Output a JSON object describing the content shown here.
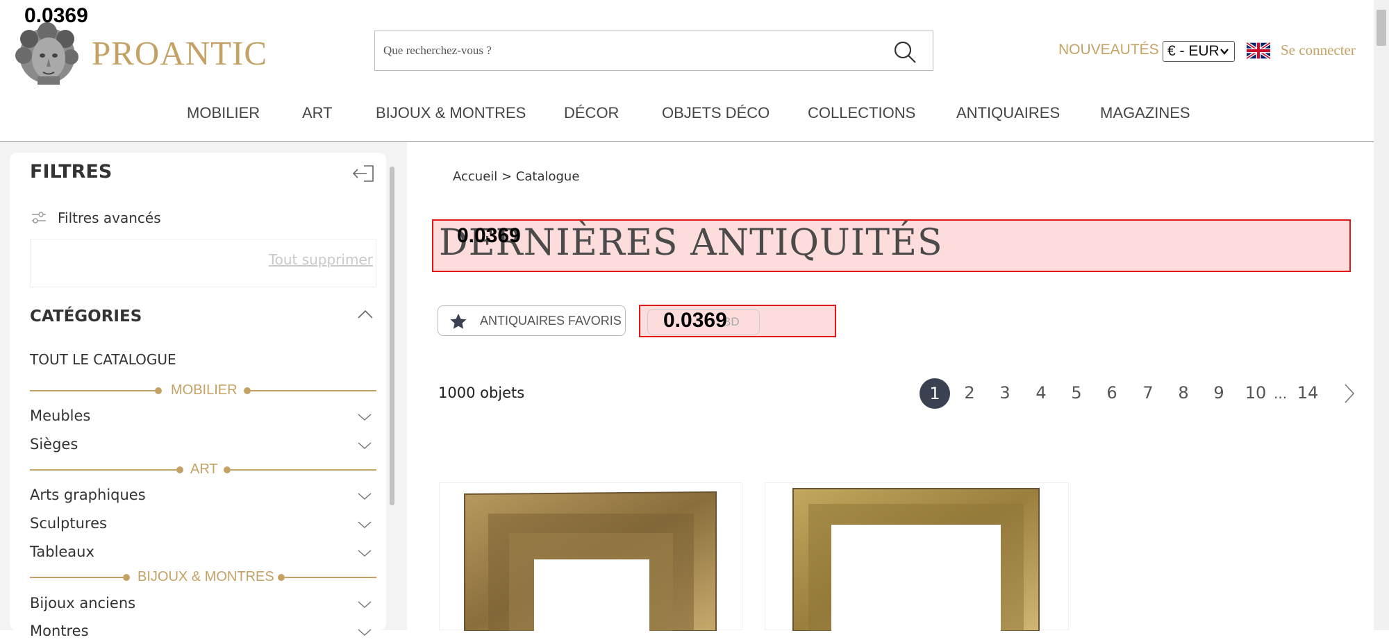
{
  "overlay_value": "0.0369",
  "brand": {
    "name": "PROANTIC"
  },
  "search": {
    "placeholder": "Que recherchez-vous ?"
  },
  "header": {
    "nouveautes": "NOUVEAUTÉS",
    "currency": "€ - EUR",
    "login": "Se connecter"
  },
  "nav": {
    "items": [
      "MOBILIER",
      "ART",
      "BIJOUX & MONTRES",
      "DÉCOR",
      "OBJETS DÉCO",
      "COLLECTIONS",
      "ANTIQUAIRES",
      "MAGAZINES"
    ]
  },
  "sidebar": {
    "title": "FILTRES",
    "advanced": "Filtres avancés",
    "clear_all": "Tout supprimer",
    "categories_title": "CATÉGORIES",
    "all_catalog": "TOUT LE CATALOGUE",
    "groups": [
      {
        "label": "MOBILIER",
        "items": [
          "Meubles",
          "Sièges"
        ]
      },
      {
        "label": "ART",
        "items": [
          "Arts graphiques",
          "Sculptures",
          "Tableaux"
        ]
      },
      {
        "label": "BIJOUX & MONTRES",
        "items": [
          "Bijoux anciens",
          "Montres"
        ]
      }
    ]
  },
  "main": {
    "breadcrumb": "Accueil > Catalogue",
    "title": "DERNIÈRES ANTIQUITÉS",
    "fav_button": "ANTIQUAIRES FAVORIS",
    "second_button": "BD",
    "count": "1000 objets",
    "pagination": {
      "current": "1",
      "pages": [
        "2",
        "3",
        "4",
        "5",
        "6",
        "7",
        "8",
        "9",
        "10"
      ],
      "ellipsis": "...",
      "last": "14"
    }
  },
  "colors": {
    "gold": "#c4a265",
    "highlight_border": "#e01818",
    "highlight_fill": "#fddcdc",
    "dark_pill": "#3a4150"
  }
}
